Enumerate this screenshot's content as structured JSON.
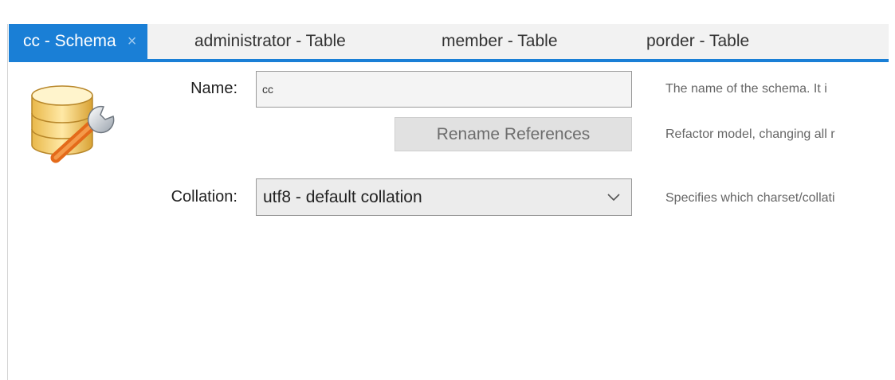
{
  "tabs": [
    {
      "label": "cc - Schema",
      "active": true,
      "close_glyph": "×"
    },
    {
      "label": "administrator - Table"
    },
    {
      "label": "member - Table"
    },
    {
      "label": "porder - Table"
    }
  ],
  "form": {
    "name_label": "Name:",
    "name_value": "cc",
    "rename_button": "Rename References",
    "collation_label": "Collation:",
    "collation_value": "utf8 - default collation"
  },
  "descriptions": {
    "name": "The name of the schema. It i",
    "rename": "Refactor model, changing all r",
    "collation": "Specifies which charset/collati"
  },
  "icons": {
    "schema_icon": "database-wrench-icon",
    "dropdown_icon": "chevron-down-icon"
  },
  "colors": {
    "accent": "#1a7fd6",
    "tab_bar": "#f2f2f2"
  }
}
